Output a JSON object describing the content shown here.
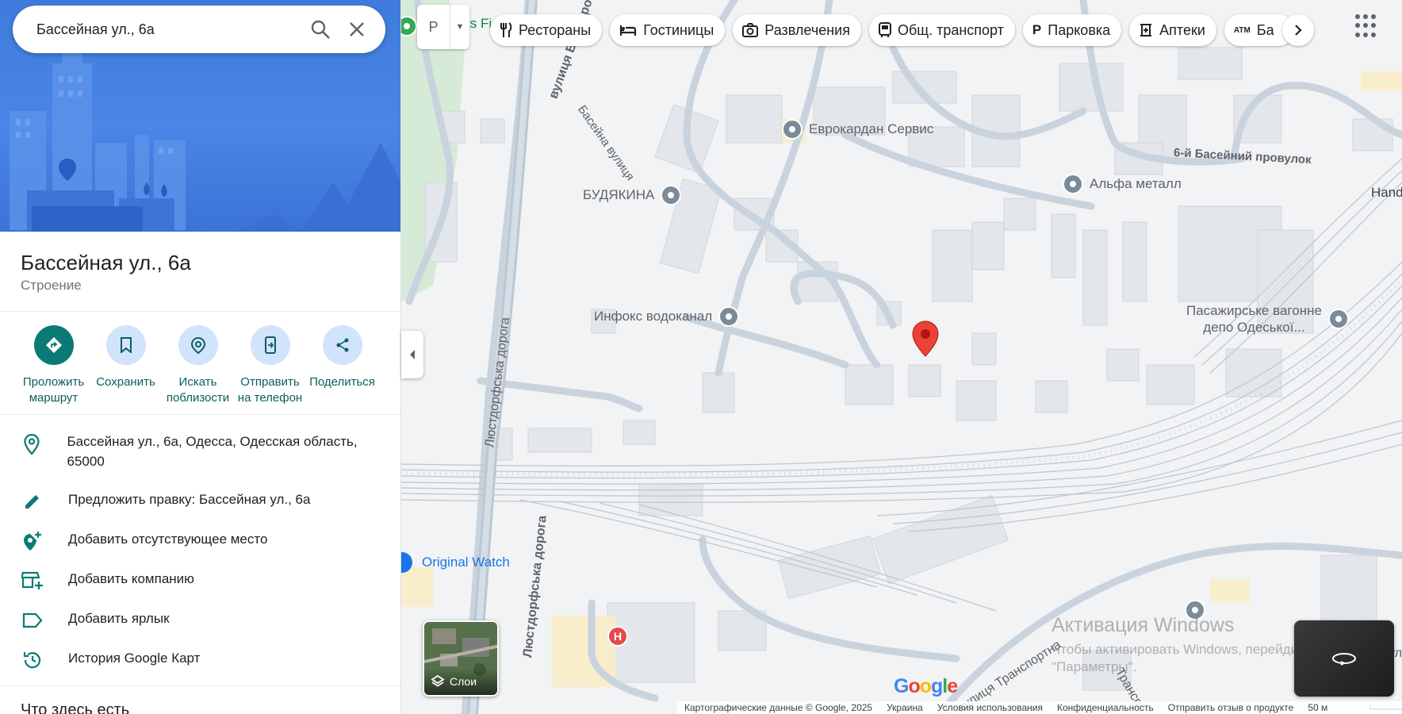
{
  "search": {
    "query": "Бассейная ул., 6а"
  },
  "place": {
    "title": "Бассейная ул., 6а",
    "category": "Строение"
  },
  "actions": [
    {
      "label": "Проложить\nмаршрут",
      "icon": "directions-icon"
    },
    {
      "label": "Сохранить",
      "icon": "bookmark-icon"
    },
    {
      "label": "Искать\nпоблизости",
      "icon": "nearby-icon"
    },
    {
      "label": "Отправить\nна телефон",
      "icon": "send-to-phone-icon"
    },
    {
      "label": "Поделиться",
      "icon": "share-icon"
    }
  ],
  "info": {
    "address": "Бассейная ул., 6а, Одесса, Одесская область, 65000",
    "suggest_edit": "Предложить правку: Бассейная ул., 6а",
    "add_place": "Добавить отсутствующее место",
    "add_business": "Добавить компанию",
    "add_label": "Добавить ярлык",
    "history": "История Google Карт"
  },
  "section_title": "Что здесь есть",
  "chips": {
    "restaurants": "Рестораны",
    "hotels": "Гостиницы",
    "entertainment": "Развлечения",
    "transit": "Общ. транспорт",
    "parking": "Парковка",
    "pharmacies": "Аптеки",
    "atm": "Ба"
  },
  "chip_icons": {
    "parking": "P",
    "atm": "ATM"
  },
  "route_button": {
    "label": "Р"
  },
  "map": {
    "poi": {
      "evrokardan": "Еврокардан Сервис",
      "alfa": "Альфа металл",
      "budyakina": "БУДЯКИНА",
      "infoks": "Инфокс водоканал",
      "depo_line1": "Пасажирське вагонне",
      "depo_line2": "депо Одеської...",
      "original_watch": "Original Watch",
      "hand_wash": "Hand wa",
      "lets_fit": "ts Fi"
    },
    "streets": {
      "vodoprovidna": "вулиця Водопровідна",
      "baseina": "Басейна вулиця",
      "lustdorfska_1": "Люстдорфська дорога",
      "lustdorfska_2": "Люстдорфська дорога",
      "baseinyi_lane": "6-й Басейний провулок",
      "transportna": "вулиця Транспортна",
      "transportna_2": "Транспо",
      "vul": "вул"
    },
    "hospital_letter": "H"
  },
  "layers": {
    "label": "Слои"
  },
  "google_logo": [
    "G",
    "o",
    "o",
    "g",
    "l",
    "e"
  ],
  "footer": {
    "map_data": "Картографические данные © Google, 2025",
    "country": "Украина",
    "terms": "Условия использования",
    "privacy": "Конфиденциальность",
    "feedback": "Отправить отзыв о продукте",
    "scale": "50 м"
  },
  "watermark": {
    "title": "Активация Windows",
    "line1": "Чтобы активировать Windows, перейдите в раздел",
    "line2": "\"Параметры\"."
  },
  "colors": {
    "accent": "#0b7a75",
    "marker": "#ea4335",
    "hero": "#4a86e6"
  }
}
